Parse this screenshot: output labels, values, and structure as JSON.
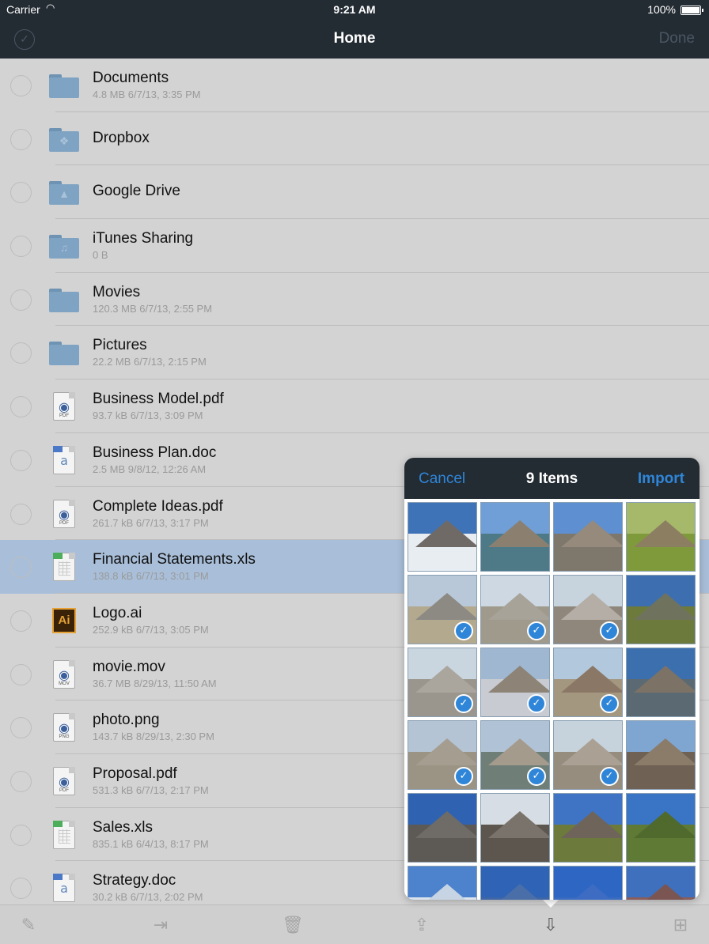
{
  "status_bar": {
    "carrier": "Carrier",
    "time": "9:21 AM",
    "battery": "100%"
  },
  "nav": {
    "title": "Home",
    "done_label": "Done"
  },
  "files": [
    {
      "name": "Documents",
      "meta": "4.8 MB 6/7/13, 3:35 PM",
      "kind": "folder",
      "glyph": ""
    },
    {
      "name": "Dropbox",
      "meta": "",
      "kind": "folder",
      "glyph": "❖"
    },
    {
      "name": "Google Drive",
      "meta": "",
      "kind": "folder",
      "glyph": "▲"
    },
    {
      "name": "iTunes Sharing",
      "meta": "0 B",
      "kind": "folder",
      "glyph": "♫"
    },
    {
      "name": "Movies",
      "meta": "120.3 MB 6/7/13, 2:55 PM",
      "kind": "folder",
      "glyph": ""
    },
    {
      "name": "Pictures",
      "meta": "22.2 MB 6/7/13, 2:15 PM",
      "kind": "folder",
      "glyph": ""
    },
    {
      "name": "Business Model.pdf",
      "meta": "93.7 kB 6/7/13, 3:09 PM",
      "kind": "pdf",
      "tag": "PDF"
    },
    {
      "name": "Business Plan.doc",
      "meta": "2.5 MB 9/8/12, 12:26 AM",
      "kind": "doc"
    },
    {
      "name": "Complete Ideas.pdf",
      "meta": "261.7 kB 6/7/13, 3:17 PM",
      "kind": "pdf",
      "tag": "PDF"
    },
    {
      "name": "Financial Statements.xls",
      "meta": "138.8 kB 6/7/13, 3:01 PM",
      "kind": "xls",
      "selected": true
    },
    {
      "name": "Logo.ai",
      "meta": "252.9 kB 6/7/13, 3:05 PM",
      "kind": "ai",
      "glyph": "Ai"
    },
    {
      "name": "movie.mov",
      "meta": "36.7 MB 8/29/13, 11:50 AM",
      "kind": "mov",
      "tag": "MOV"
    },
    {
      "name": "photo.png",
      "meta": "143.7 kB 8/29/13, 2:30 PM",
      "kind": "png",
      "tag": "PNG"
    },
    {
      "name": "Proposal.pdf",
      "meta": "531.3 kB 6/7/13, 2:17 PM",
      "kind": "pdf",
      "tag": "PDF"
    },
    {
      "name": "Sales.xls",
      "meta": "835.1 kB 6/4/13, 8:17 PM",
      "kind": "xls"
    },
    {
      "name": "Strategy.doc",
      "meta": "30.2 kB 6/7/13, 2:02 PM",
      "kind": "doc"
    }
  ],
  "popover": {
    "cancel_label": "Cancel",
    "count_label": "9 Items",
    "import_label": "Import",
    "photos": [
      {
        "sky": "#3f73b8",
        "land": "#e8edf2",
        "peak": "#6f6a66",
        "checked": false
      },
      {
        "sky": "#6f9fd6",
        "land": "#4e7a88",
        "peak": "#8b8070",
        "checked": false
      },
      {
        "sky": "#5e8fd0",
        "land": "#7e776c",
        "peak": "#958a7c",
        "checked": false
      },
      {
        "sky": "#a6b86a",
        "land": "#7f9a3a",
        "peak": "#8c7f61",
        "checked": false
      },
      {
        "sky": "#b8c8d8",
        "land": "#b3a98f",
        "peak": "#8d8a84",
        "checked": true
      },
      {
        "sky": "#cdd8e2",
        "land": "#9f9a8c",
        "peak": "#a7a399",
        "checked": true
      },
      {
        "sky": "#c7d3dd",
        "land": "#8f877b",
        "peak": "#b4aea6",
        "checked": true
      },
      {
        "sky": "#3d6fb0",
        "land": "#6c7b3c",
        "peak": "#6f725c",
        "checked": false
      },
      {
        "sky": "#c9d5df",
        "land": "#9a968d",
        "peak": "#aaa59d",
        "checked": true
      },
      {
        "sky": "#9fb7d0",
        "land": "#c8ccd2",
        "peak": "#8d8377",
        "checked": true
      },
      {
        "sky": "#b2c8dc",
        "land": "#a39780",
        "peak": "#8b7765",
        "checked": true
      },
      {
        "sky": "#3c6fae",
        "land": "#5b6a72",
        "peak": "#7d7266",
        "checked": false
      },
      {
        "sky": "#b4c4d4",
        "land": "#9b9384",
        "peak": "#a59d90",
        "checked": true
      },
      {
        "sky": "#b0c3d6",
        "land": "#6f7f78",
        "peak": "#a59b8c",
        "checked": true
      },
      {
        "sky": "#c6d2dc",
        "land": "#968d7e",
        "peak": "#aaa194",
        "checked": true
      },
      {
        "sky": "#7fa5d1",
        "land": "#6f6153",
        "peak": "#8b7c6a",
        "checked": false
      },
      {
        "sky": "#2f62b0",
        "land": "#5d5a55",
        "peak": "#6f6b66",
        "checked": false
      },
      {
        "sky": "#d7dde4",
        "land": "#5c564f",
        "peak": "#7a736b",
        "checked": false
      },
      {
        "sky": "#3f74c4",
        "land": "#6c7a3c",
        "peak": "#6e6459",
        "checked": false
      },
      {
        "sky": "#3a74c4",
        "land": "#5f7a35",
        "peak": "#4f6a2c",
        "checked": false
      },
      {
        "sky": "#4d82cc",
        "land": "#dbe4ee",
        "peak": "#c6d4e3",
        "checked": false
      },
      {
        "sky": "#2f63b6",
        "land": "#3f66a6",
        "peak": "#4a6fa8",
        "checked": false
      },
      {
        "sky": "#2e66c4",
        "land": "#3a6cc0",
        "peak": "#3d6cc2",
        "checked": false
      },
      {
        "sky": "#3e70bd",
        "land": "#8a5d5a",
        "peak": "#7b5552",
        "checked": false
      }
    ]
  },
  "toolbar": {
    "icons": [
      "pencil-icon",
      "move-icon",
      "trash-icon",
      "share-icon",
      "import-icon",
      "new-folder-icon"
    ]
  }
}
